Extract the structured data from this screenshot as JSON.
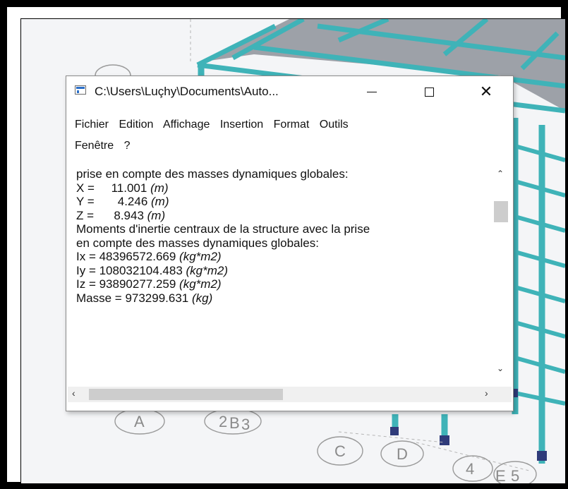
{
  "window": {
    "title": "C:\\Users\\Luçhy\\Documents\\Auto...",
    "menu_row1": [
      "Fichier",
      "Edition",
      "Affichage",
      "Insertion",
      "Format",
      "Outils"
    ],
    "menu_row2": [
      "Fenêtre",
      "?"
    ]
  },
  "content": {
    "heading": "prise en compte des masses dynamiques globales:",
    "x_label": "X =     11.001 ",
    "x_unit": "(m)",
    "y_label": "Y =       4.246 ",
    "y_unit": "(m)",
    "z_label": "Z =      8.943 ",
    "z_unit": "(m)",
    "moments_line1": "Moments d'inertie centraux de la structure avec la prise",
    "moments_line2": "en compte des masses dynamiques globales:",
    "ix_label": "Ix = 48396572.669 ",
    "ix_unit": "(kg*m2)",
    "iy_label": "Iy = 108032104.483 ",
    "iy_unit": "(kg*m2)",
    "iz_label": "Iz = 93890277.259 ",
    "iz_unit": "(kg*m2)",
    "mass_label": "Masse = 973299.631 ",
    "mass_unit": "(kg)"
  },
  "background_labels": [
    "A",
    "2",
    "B",
    "3",
    "C",
    "D",
    "4",
    "E",
    "5"
  ],
  "colors": {
    "beam": "#3fb3b8",
    "slab": "#8d929a",
    "background": "#f4f5f7",
    "support": "#2f3b7a"
  }
}
